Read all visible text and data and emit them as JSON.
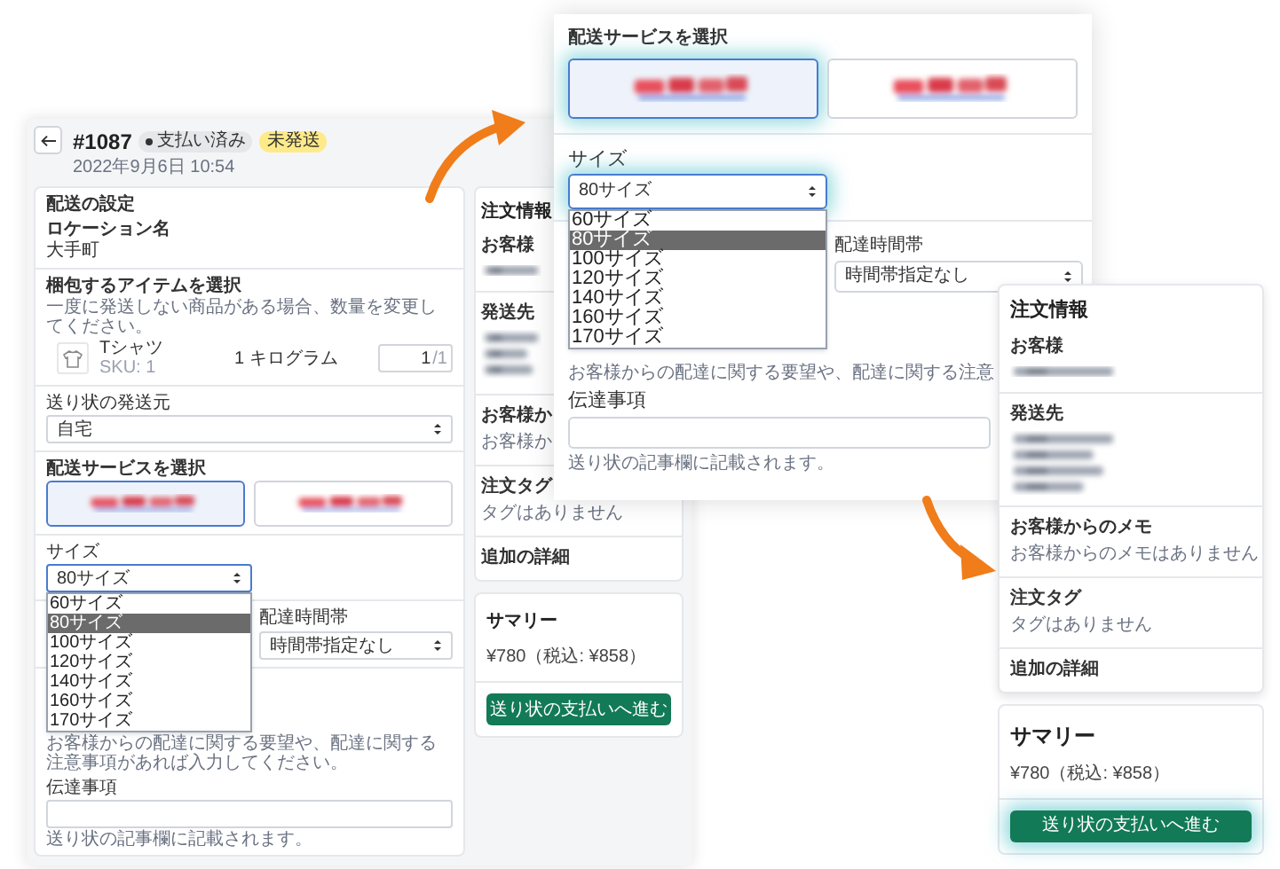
{
  "order_page": {
    "order_number": "#1087",
    "payment_badge": "支払い済み",
    "fulfillment_badge": "未発送",
    "date": "2022年9月6日 10:54",
    "section_title": "配送の設定",
    "location_label": "ロケーション名",
    "location": "大手町",
    "items_title": "梱包するアイテムを選択",
    "items_hint": "一度に発送しない商品がある場合、数量を変更してください。",
    "item": {
      "name": "Tシャツ",
      "sku": "SKU: 1",
      "weight": "1 キログラム",
      "quantity": "1",
      "quantity_max": "/1"
    },
    "origin_label": "送り状の発送元",
    "origin": "自宅",
    "service_title": "配送サービスを選択",
    "services": [
      {
        "kind": "picture",
        "selected": true
      },
      {
        "kind": "picture",
        "selected": false
      }
    ],
    "size_label": "サイズ",
    "size_value": "80サイズ",
    "size_options": [
      {
        "label": "60サイズ",
        "selected": false
      },
      {
        "label": "80サイズ",
        "selected": true
      },
      {
        "label": "100サイズ",
        "selected": false
      },
      {
        "label": "120サイズ",
        "selected": false
      },
      {
        "label": "140サイズ",
        "selected": false
      },
      {
        "label": "160サイズ",
        "selected": false
      },
      {
        "label": "170サイズ",
        "selected": false
      }
    ],
    "time_label": "配達時間帯",
    "time_value": "時間帯指定なし",
    "request_hint": "お客様からの配達に関する要望や、配達に関する注意事項があれば入力してください。",
    "note_label": "伝達事項",
    "note_hint": "送り状の記事欄に記載されます。",
    "sidebar": {
      "title": "注文情報",
      "sections": [
        {
          "label": "お客様",
          "kind": "picture"
        },
        {
          "label": "発送先",
          "kind": "picture"
        },
        {
          "label": "お客様か",
          "kind": "text",
          "text": "お客様か"
        },
        {
          "label": "注文タグ",
          "kind": "text",
          "text": "タグはありません"
        },
        {
          "label": "追加の詳細",
          "kind": "label"
        }
      ],
      "summary_title": "サマリー",
      "total": "¥780（税込: ¥858）",
      "pay_button": "送り状の支払いへ進む"
    }
  },
  "zoom_view": {
    "service_title": "配送サービスを選択",
    "services": [
      {
        "kind": "picture",
        "selected": true
      },
      {
        "kind": "picture",
        "selected": false
      }
    ],
    "size_label": "サイズ",
    "size_value": "80サイズ",
    "size_options": [
      {
        "label": "60サイズ",
        "selected": false
      },
      {
        "label": "80サイズ",
        "selected": true
      },
      {
        "label": "100サイズ",
        "selected": false
      },
      {
        "label": "120サイズ",
        "selected": false
      },
      {
        "label": "140サイズ",
        "selected": false
      },
      {
        "label": "160サイズ",
        "selected": false
      },
      {
        "label": "170サイズ",
        "selected": false
      }
    ],
    "time_label": "配達時間帯",
    "time_value": "時間帯指定なし",
    "request_hint": "お客様からの配達に関する要望や、配達に関する注意",
    "note_label": "伝達事項",
    "note_hint": "送り状の記事欄に記載されます。"
  },
  "sidebar_closeup": {
    "title": "注文情報",
    "sections": [
      {
        "label": "お客様",
        "kind": "picture"
      },
      {
        "label": "発送先",
        "kind": "picture"
      },
      {
        "label": "お客様からのメモ",
        "kind": "text",
        "text": "お客様からのメモはありません"
      },
      {
        "label": "注文タグ",
        "kind": "text",
        "text": "タグはありません"
      },
      {
        "label": "追加の詳細",
        "kind": "label"
      }
    ],
    "summary_title": "サマリー",
    "total": "¥780（税込: ¥858）",
    "pay_button": "送り状の支払いへ進む"
  }
}
